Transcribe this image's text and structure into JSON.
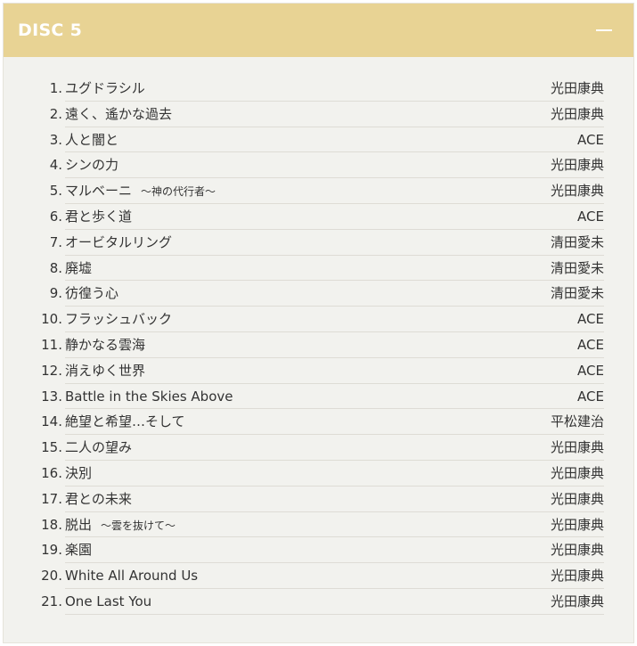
{
  "disc": {
    "title": "DISC 5",
    "collapse_icon": "minus-icon"
  },
  "tracks": [
    {
      "num": "1.",
      "title": "ユグドラシル",
      "sub": "",
      "artist": "光田康典"
    },
    {
      "num": "2.",
      "title": "遠く、遙かな過去",
      "sub": "",
      "artist": "光田康典"
    },
    {
      "num": "3.",
      "title": "人と闇と",
      "sub": "",
      "artist": "ACE"
    },
    {
      "num": "4.",
      "title": "シンの力",
      "sub": "",
      "artist": "光田康典"
    },
    {
      "num": "5.",
      "title": "マルベーニ",
      "sub": "～神の代行者～",
      "artist": "光田康典"
    },
    {
      "num": "6.",
      "title": "君と歩く道",
      "sub": "",
      "artist": "ACE"
    },
    {
      "num": "7.",
      "title": "オービタルリング",
      "sub": "",
      "artist": "清田愛未"
    },
    {
      "num": "8.",
      "title": "廃墟",
      "sub": "",
      "artist": "清田愛未"
    },
    {
      "num": "9.",
      "title": "彷徨う心",
      "sub": "",
      "artist": "清田愛未"
    },
    {
      "num": "10.",
      "title": "フラッシュバック",
      "sub": "",
      "artist": "ACE"
    },
    {
      "num": "11.",
      "title": "静かなる雲海",
      "sub": "",
      "artist": "ACE"
    },
    {
      "num": "12.",
      "title": "消えゆく世界",
      "sub": "",
      "artist": "ACE"
    },
    {
      "num": "13.",
      "title": "Battle in the Skies Above",
      "sub": "",
      "artist": "ACE"
    },
    {
      "num": "14.",
      "title": "絶望と希望…そして",
      "sub": "",
      "artist": "平松建治"
    },
    {
      "num": "15.",
      "title": "二人の望み",
      "sub": "",
      "artist": "光田康典"
    },
    {
      "num": "16.",
      "title": "決別",
      "sub": "",
      "artist": "光田康典"
    },
    {
      "num": "17.",
      "title": "君との未来",
      "sub": "",
      "artist": "光田康典"
    },
    {
      "num": "18.",
      "title": "脱出",
      "sub": "～雲を抜けて～",
      "artist": "光田康典"
    },
    {
      "num": "19.",
      "title": "楽園",
      "sub": "",
      "artist": "光田康典"
    },
    {
      "num": "20.",
      "title": "White All Around Us",
      "sub": "",
      "artist": "光田康典"
    },
    {
      "num": "21.",
      "title": "One Last You",
      "sub": "",
      "artist": "光田康典"
    }
  ]
}
